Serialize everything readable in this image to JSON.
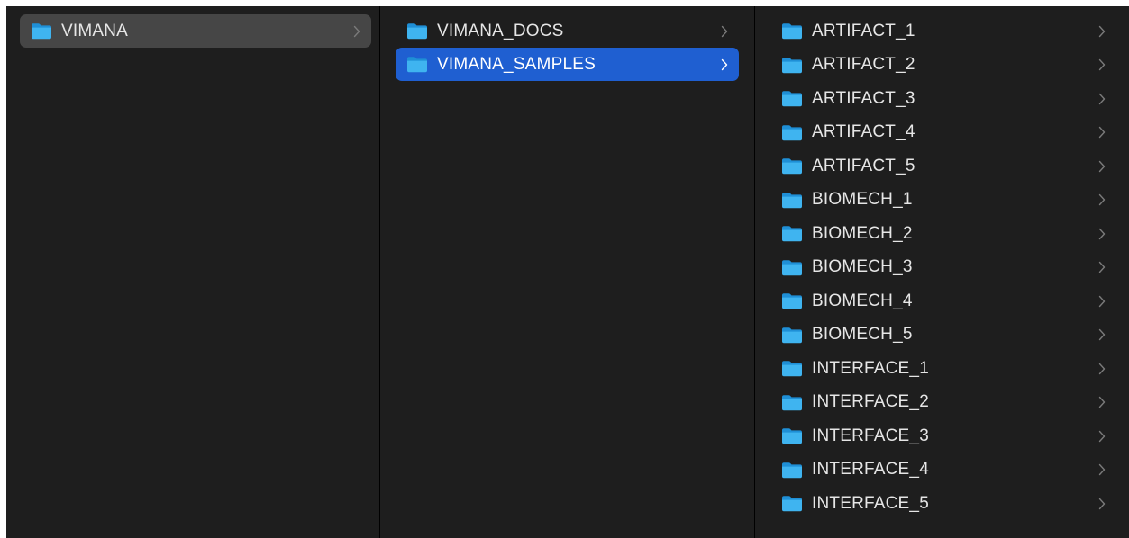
{
  "columns": [
    {
      "items": [
        {
          "label": "VIMANA",
          "state": "selected-inactive"
        }
      ]
    },
    {
      "items": [
        {
          "label": "VIMANA_DOCS",
          "state": "normal"
        },
        {
          "label": "VIMANA_SAMPLES",
          "state": "selected-active"
        }
      ]
    },
    {
      "items": [
        {
          "label": "ARTIFACT_1",
          "state": "normal"
        },
        {
          "label": "ARTIFACT_2",
          "state": "normal"
        },
        {
          "label": "ARTIFACT_3",
          "state": "normal"
        },
        {
          "label": "ARTIFACT_4",
          "state": "normal"
        },
        {
          "label": "ARTIFACT_5",
          "state": "normal"
        },
        {
          "label": "BIOMECH_1",
          "state": "normal"
        },
        {
          "label": "BIOMECH_2",
          "state": "normal"
        },
        {
          "label": "BIOMECH_3",
          "state": "normal"
        },
        {
          "label": "BIOMECH_4",
          "state": "normal"
        },
        {
          "label": "BIOMECH_5",
          "state": "normal"
        },
        {
          "label": "INTERFACE_1",
          "state": "normal"
        },
        {
          "label": "INTERFACE_2",
          "state": "normal"
        },
        {
          "label": "INTERFACE_3",
          "state": "normal"
        },
        {
          "label": "INTERFACE_4",
          "state": "normal"
        },
        {
          "label": "INTERFACE_5",
          "state": "normal"
        }
      ]
    }
  ],
  "icons": {
    "row_icon": "folder-icon",
    "disclosure_icon": "chevron-right-icon"
  },
  "colors": {
    "background": "#1e1e1e",
    "selection_active": "#1f5fd1",
    "selection_inactive": "#464646",
    "folder_front": "#3fb4f0",
    "folder_back": "#1f8fd6",
    "text": "#e6e6e6"
  }
}
